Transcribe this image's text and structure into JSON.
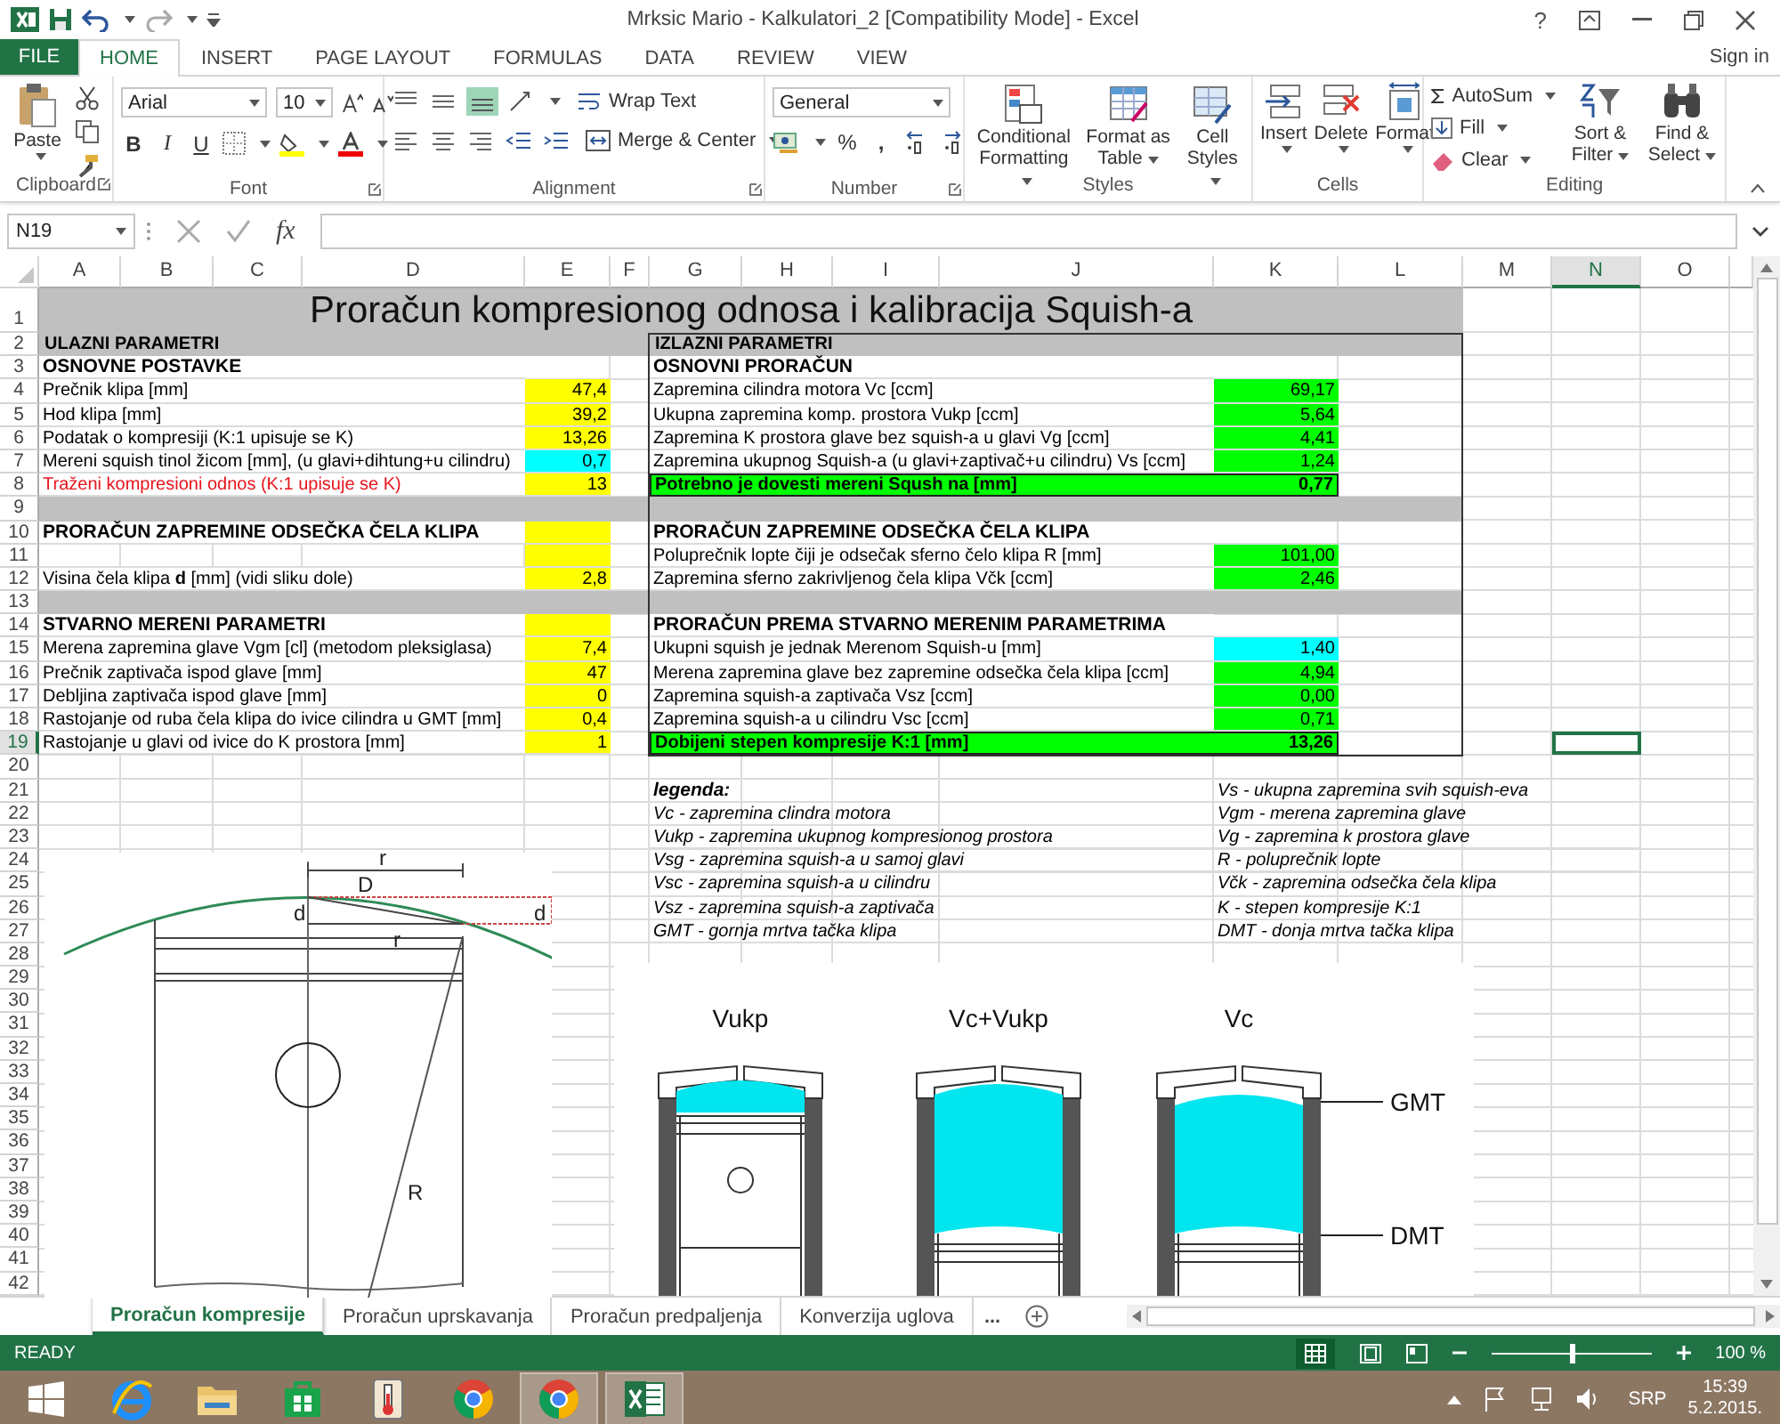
{
  "window": {
    "title": "Mrksic Mario - Kalkulatori_2  [Compatibility Mode] - Excel",
    "help": "?"
  },
  "file_tab": "FILE",
  "ribbon_tabs": [
    {
      "label": "HOME",
      "selected": true
    },
    {
      "label": "INSERT",
      "selected": false
    },
    {
      "label": "PAGE LAYOUT",
      "selected": false
    },
    {
      "label": "FORMULAS",
      "selected": false
    },
    {
      "label": "DATA",
      "selected": false
    },
    {
      "label": "REVIEW",
      "selected": false
    },
    {
      "label": "VIEW",
      "selected": false
    }
  ],
  "sign_in": "Sign in",
  "ribbon": {
    "clipboard": {
      "label": "Clipboard",
      "paste": "Paste"
    },
    "font": {
      "label": "Font",
      "font_name": "Arial",
      "font_size": "10",
      "style_buttons": [
        "B",
        "I",
        "U"
      ]
    },
    "alignment": {
      "label": "Alignment",
      "wrap_text": "Wrap Text",
      "merge": "Merge & Center"
    },
    "number": {
      "label": "Number",
      "format": "General",
      "percent": "%",
      "comma": ","
    },
    "styles": {
      "label": "Styles",
      "buttons": [
        "Conditional Formatting",
        "Format as Table",
        "Cell Styles"
      ]
    },
    "cells": {
      "label": "Cells",
      "buttons": [
        "Insert",
        "Delete",
        "Format"
      ]
    },
    "editing": {
      "label": "Editing",
      "autosum": "AutoSum",
      "fill": "Fill",
      "clear": "Clear",
      "buttons": [
        "Sort & Filter",
        "Find & Select"
      ]
    }
  },
  "formula_bar": {
    "name_box": "N19",
    "function_label": "fx"
  },
  "sheet": {
    "column_headers": [
      {
        "label": "A",
        "selected": false
      },
      {
        "label": "B",
        "selected": false
      },
      {
        "label": "C",
        "selected": false
      },
      {
        "label": "D",
        "selected": false
      },
      {
        "label": "E",
        "selected": false
      },
      {
        "label": "F",
        "selected": false
      },
      {
        "label": "G",
        "selected": false
      },
      {
        "label": "H",
        "selected": false
      },
      {
        "label": "I",
        "selected": false
      },
      {
        "label": "J",
        "selected": false
      },
      {
        "label": "K",
        "selected": false
      },
      {
        "label": "L",
        "selected": false
      },
      {
        "label": "M",
        "selected": false
      },
      {
        "label": "N",
        "selected": true
      },
      {
        "label": "O",
        "selected": false
      }
    ],
    "row_headers": [
      {
        "label": "1",
        "selected": false
      },
      {
        "label": "2",
        "selected": false
      },
      {
        "label": "3",
        "selected": false
      },
      {
        "label": "4",
        "selected": false
      },
      {
        "label": "5",
        "selected": false
      },
      {
        "label": "6",
        "selected": false
      },
      {
        "label": "7",
        "selected": false
      },
      {
        "label": "8",
        "selected": false
      },
      {
        "label": "9",
        "selected": false
      },
      {
        "label": "10",
        "selected": false
      },
      {
        "label": "11",
        "selected": false
      },
      {
        "label": "12",
        "selected": false
      },
      {
        "label": "13",
        "selected": false
      },
      {
        "label": "14",
        "selected": false
      },
      {
        "label": "15",
        "selected": false
      },
      {
        "label": "16",
        "selected": false
      },
      {
        "label": "17",
        "selected": false
      },
      {
        "label": "18",
        "selected": false
      },
      {
        "label": "19",
        "selected": true
      },
      {
        "label": "20",
        "selected": false
      },
      {
        "label": "21",
        "selected": false
      },
      {
        "label": "22",
        "selected": false
      },
      {
        "label": "23",
        "selected": false
      },
      {
        "label": "24",
        "selected": false
      },
      {
        "label": "25",
        "selected": false
      },
      {
        "label": "26",
        "selected": false
      },
      {
        "label": "27",
        "selected": false
      },
      {
        "label": "28",
        "selected": false
      },
      {
        "label": "29",
        "selected": false
      },
      {
        "label": "30",
        "selected": false
      },
      {
        "label": "31",
        "selected": false
      },
      {
        "label": "32",
        "selected": false
      },
      {
        "label": "33",
        "selected": false
      },
      {
        "label": "34",
        "selected": false
      },
      {
        "label": "35",
        "selected": false
      },
      {
        "label": "36",
        "selected": false
      },
      {
        "label": "37",
        "selected": false
      },
      {
        "label": "38",
        "selected": false
      },
      {
        "label": "39",
        "selected": false
      },
      {
        "label": "40",
        "selected": false
      },
      {
        "label": "41",
        "selected": false
      },
      {
        "label": "42",
        "selected": false
      }
    ],
    "title": "Proračun kompresionog odnosa i kalibracija Squish-a",
    "rows": [
      {
        "kind": "band",
        "left": {
          "text": "ULAZNI PARAMETRI"
        },
        "right": {
          "text": "IZLAZNI PARAMETRI"
        }
      },
      {
        "kind": "data",
        "left": {
          "text": "OSNOVNE POSTAVKE",
          "kind": "heading"
        },
        "right": {
          "text": "OSNOVNI PRORAČUN",
          "kind": "heading"
        }
      },
      {
        "kind": "data",
        "left": {
          "text": "Prečnik klipa [mm]",
          "kind": "normal",
          "value": "47,4",
          "color": "#ffff00"
        },
        "right": {
          "text": "Zapremina cilindra motora Vc [ccm]",
          "kind": "normal",
          "value": "69,17",
          "color": "#00ff00"
        }
      },
      {
        "kind": "data",
        "left": {
          "text": "Hod klipa [mm]",
          "kind": "normal",
          "value": "39,2",
          "color": "#ffff00"
        },
        "right": {
          "text": "Ukupna zapremina komp. prostora Vukp [ccm]",
          "kind": "normal",
          "value": "5,64",
          "color": "#00ff00"
        }
      },
      {
        "kind": "data",
        "left": {
          "text": "Podatak o kompresiji (K:1 upisuje se K)",
          "kind": "normal",
          "value": "13,26",
          "color": "#ffff00"
        },
        "right": {
          "text": "Zapremina K prostora glave bez squish-a u glavi Vg [ccm]",
          "kind": "normal",
          "value": "4,41",
          "color": "#00ff00"
        }
      },
      {
        "kind": "data",
        "left": {
          "text": "Mereni squish tinol žicom [mm], (u glavi+dihtung+u cilindru)",
          "kind": "normal",
          "value": "0,7",
          "color": "#00ffff"
        },
        "right": {
          "text": "Zapremina ukupnog Squish-a (u glavi+zaptivač+u cilindru) Vs [ccm]",
          "kind": "normal",
          "value": "1,24",
          "color": "#00ff00"
        }
      },
      {
        "kind": "data",
        "left": {
          "text": "Traženi kompresioni odnos (K:1 upisuje se K)",
          "kind": "warning",
          "value": "13",
          "color": "#ffff00"
        },
        "right": {
          "text": "Potrebno je dovesti mereni Sqush na [mm]",
          "kind": "result",
          "value": "0,77",
          "color": "#00ff00"
        }
      },
      {
        "kind": "band"
      },
      {
        "kind": "data",
        "left": {
          "text": "PRORAČUN ZAPREMINE ODSEČKA ČELA KLIPA",
          "kind": "heading",
          "color": "#ffff00"
        },
        "right": {
          "text": "PRORAČUN ZAPREMINE ODSEČKA ČELA KLIPA",
          "kind": "heading"
        }
      },
      {
        "kind": "data",
        "left": {
          "color": "#ffff00"
        },
        "right": {
          "text": "Poluprečnik lopte čiji je odsečak sferno čelo klipa R [mm]",
          "kind": "normal",
          "value": "101,00",
          "color": "#00ff00"
        }
      },
      {
        "kind": "data",
        "left": {
          "text": "Visina čela klipa **d** [mm] (vidi sliku dole)",
          "kind": "normal",
          "value": "2,8",
          "color": "#ffff00"
        },
        "right": {
          "text": "Zapremina sferno zakrivljenog čela klipa Včk [ccm]",
          "kind": "normal",
          "value": "2,46",
          "color": "#00ff00"
        }
      },
      {
        "kind": "band"
      },
      {
        "kind": "data",
        "left": {
          "text": "STVARNO MERENI PARAMETRI",
          "kind": "heading",
          "color": "#ffff00"
        },
        "right": {
          "text": "PRORAČUN PREMA STVARNO MERENIM PARAMETRIMA",
          "kind": "heading"
        }
      },
      {
        "kind": "data",
        "left": {
          "text": "Merena zapremina glave Vgm [cl] (metodom pleksiglasa)",
          "kind": "normal",
          "value": "7,4",
          "color": "#ffff00"
        },
        "right": {
          "text": "Ukupni squish je jednak Merenom Squish-u [mm]",
          "kind": "normal",
          "value": "1,40",
          "color": "#00ffff"
        }
      },
      {
        "kind": "data",
        "left": {
          "text": "Prečnik zaptivača ispod glave [mm]",
          "kind": "normal",
          "value": "47",
          "color": "#ffff00"
        },
        "right": {
          "text": "Merena zapremina glave bez zapremine odsečka čela klipa [ccm]",
          "kind": "normal",
          "value": "4,94",
          "color": "#00ff00"
        }
      },
      {
        "kind": "data",
        "left": {
          "text": "Debljina zaptivača ispod glave [mm]",
          "kind": "normal",
          "value": "0",
          "color": "#ffff00"
        },
        "right": {
          "text": "Zapremina squish-a zaptivača Vsz [ccm]",
          "kind": "normal",
          "value": "0,00",
          "color": "#00ff00"
        }
      },
      {
        "kind": "data",
        "left": {
          "text": "Rastojanje od ruba čela klipa do ivice cilindra u GMT [mm]",
          "kind": "normal",
          "value": "0,4",
          "color": "#ffff00"
        },
        "right": {
          "text": "Zapremina squish-a u cilindru Vsc [ccm]",
          "kind": "normal",
          "value": "0,71",
          "color": "#00ff00"
        }
      },
      {
        "kind": "data",
        "left": {
          "text": "Rastojanje u glavi od ivice do K prostora [mm]",
          "kind": "normal",
          "value": "1",
          "color": "#ffff00"
        },
        "right": {
          "text": "Dobijeni stepen kompresije K:1 [mm]",
          "kind": "result",
          "value": "13,26",
          "color": "#00ff00"
        }
      },
      {
        "kind": "blank"
      },
      {
        "kind": "legend",
        "left": {
          "text": "legenda:",
          "kind": "heading"
        },
        "right": {
          "text": "Vs - ukupna zapremina svih squish-eva",
          "kind": "normal"
        }
      },
      {
        "kind": "legend",
        "left": {
          "text": "Vc - zapremina clindra motora",
          "kind": "normal"
        },
        "right": {
          "text": "Vgm - merena zapremina glave",
          "kind": "normal"
        }
      },
      {
        "kind": "legend",
        "left": {
          "text": "Vukp - zapremina ukupnog kompresionog prostora",
          "kind": "normal"
        },
        "right": {
          "text": "Vg - zapremina k prostora glave",
          "kind": "normal"
        }
      },
      {
        "kind": "legend",
        "left": {
          "text": "Vsg - zapremina squish-a u samoj glavi",
          "kind": "normal"
        },
        "right": {
          "text": "R - poluprečnik lopte",
          "kind": "normal"
        }
      },
      {
        "kind": "legend",
        "left": {
          "text": "Vsc - zapremina squish-a u cilindru",
          "kind": "normal"
        },
        "right": {
          "text": "Včk - zapremina odsečka čela klipa",
          "kind": "normal"
        }
      },
      {
        "kind": "legend",
        "left": {
          "text": "Vsz - zapremina squish-a zaptivača",
          "kind": "normal"
        },
        "right": {
          "text": "K - stepen kompresije K:1",
          "kind": "normal"
        }
      },
      {
        "kind": "legend",
        "left": {
          "text": "GMT - gornja mrtva tačka klipa",
          "kind": "normal"
        },
        "right": {
          "text": "DMT - donja mrtva tačka klipa",
          "kind": "normal"
        }
      }
    ],
    "piston_diagram": {
      "top_radius": "r",
      "chord": "D",
      "left_height": "d",
      "right_height": "d",
      "inner_radius": "r",
      "sphere_radius": "R"
    },
    "cycle_diagram": {
      "piston_labels": [
        "Vukp",
        "Vc+Vukp",
        "Vc"
      ],
      "position_labels": [
        "GMT",
        "DMT"
      ]
    }
  },
  "sheet_tabs": [
    {
      "label": "Proračun kompresije",
      "selected": true
    },
    {
      "label": "Proračun uprskavanja",
      "selected": false
    },
    {
      "label": "Proračun predpaljenja",
      "selected": false
    },
    {
      "label": "Konverzija uglova",
      "selected": false
    }
  ],
  "more_tabs": "...",
  "status_bar": {
    "status": "READY",
    "zoom": "100 %",
    "zoom_slider": {
      "level": 0.5
    }
  },
  "taskbar": {
    "apps": [
      {
        "kind": "ie",
        "active": false
      },
      {
        "kind": "explorer",
        "active": false
      },
      {
        "kind": "store",
        "active": false
      },
      {
        "kind": "thermo",
        "active": false
      },
      {
        "kind": "chrome",
        "active": false
      },
      {
        "kind": "chrome",
        "active": true
      },
      {
        "kind": "excel",
        "active": true
      }
    ],
    "language": "SRP",
    "time": "15:39",
    "date": "5.2.2015."
  }
}
